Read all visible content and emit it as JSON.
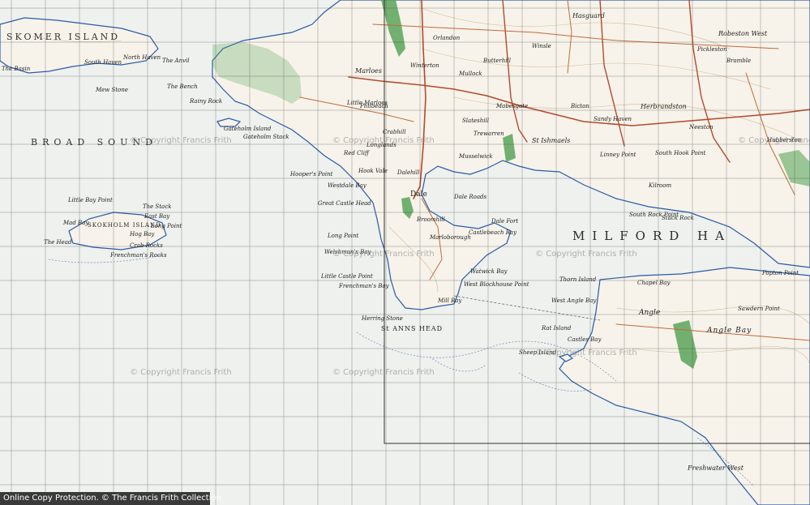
{
  "map": {
    "labels": {
      "skomer_island": "SKOMER ISLAND",
      "broad_sound": "BROAD SOUND",
      "milford_haven": "MILFORD HA",
      "st_anns_head": "St ANNS HEAD",
      "angle_bay": "Angle Bay",
      "skokholm_island": "SKOKHOLM ISLAND",
      "marloes": "Marloes",
      "dale": "Dale",
      "dale_roads": "Dale Roads",
      "hasguard": "Hasguard",
      "herbrandston": "Herbrandston",
      "robeston_west": "Robeston West",
      "st_ishmaels": "St Ishmaels",
      "angle": "Angle",
      "little_marloes": "Little Marloes",
      "mullock": "Mullock",
      "winterton": "Winterton",
      "orlandon": "Orlandon",
      "hooks_vale": "Hook Vale",
      "westdale_bay": "Westdale Bay",
      "great_castle_head": "Great Castle Head",
      "long_point": "Long Point",
      "welshmans_bay": "Welshman's Bay",
      "little_castle_point": "Little Castle Point",
      "frenchmans_bay": "Frenchman's Bay",
      "herring_stone": "Herring Stone",
      "mill_bay": "Mill Bay",
      "west_blockhouse_point": "West Blockhouse Point",
      "watwick_bay": "Watwick Bay",
      "castlebeach_bay": "Castlebeach Bay",
      "dale_fort": "Dale Fort",
      "marloborough": "Marloborough",
      "broomhill": "Broomhill",
      "thorn_island": "Thorn Island",
      "west_angle_bay": "West Angle Bay",
      "chapel_bay": "Chapel Bay",
      "rat_island": "Rat Island",
      "sheep_island": "Sheep Island",
      "castles_bay": "Castles Bay",
      "freshwater_west": "Freshwater West",
      "mew_stone": "Mew Stone",
      "the_basin": "The Basin",
      "the_head": "The Head",
      "crab_rocks": "Crab Rocks",
      "frenchmans_rocks": "Frenchman's Rocks",
      "the_stack": "The Stack",
      "east_bay": "East Bay",
      "long_point_s": "Long Point",
      "hog_bay": "Hog Bay",
      "mad_bay": "Mad Bay",
      "little_bay_point": "Little Bay Point",
      "north_haven": "North Haven",
      "south_haven": "South Haven",
      "the_anvil": "The Anvil",
      "the_bench": "The Bench",
      "rainy_rock": "Rainy Rock",
      "gateholm_island": "Gateholm Island",
      "gateholm_stack": "Gateholm Stack",
      "hoopers_point": "Hooper's Point",
      "red_cliff": "Red Cliff",
      "longlands": "Longlands",
      "dalehill": "Dalehill",
      "crabhill": "Crabhill",
      "philbeach": "Philbeach",
      "musselwick": "Musselwick",
      "butterhill": "Butterhill",
      "winsle": "Winsle",
      "mabesgate": "Mabesgate",
      "trewarren": "Trewarren",
      "slateshill": "Slateshill",
      "sandy_haven": "Sandy Haven",
      "bicton": "Bicton",
      "neeston": "Neeston",
      "south_hook_point": "South Hook Point",
      "stack_rock": "Stack Rock",
      "kilroom": "Kilroom",
      "south_rock_point": "South Rock Point",
      "popton_point": "Popton Point",
      "sawdern_point": "Sawdern Point",
      "bramble": "Bramble",
      "pickleston": "Pickleston",
      "hubberston": "Hubberston",
      "linney_point": "Linney Point"
    },
    "watermarks": [
      "© Copyright Francis Frith",
      "© Copyright Francis Frith",
      "© Copyright Francis Frith",
      "© Copyright Francis Frith",
      "© Copyright Francis Frith",
      "© Copyright Francis Frith",
      "© Copyright Francis Frith",
      "© Copyright Francis Frith"
    ],
    "colors": {
      "sea": "#eef1ee",
      "land": "#f7f3ea",
      "coast": "#2b5aa8",
      "grid": "#3b3b3b",
      "road_major": "#b54a2b",
      "road_minor": "#c26a3c",
      "woodland": "#5aa55a",
      "contour": "#c8a070",
      "footer_bg": "#3a3a3a"
    }
  },
  "footer": {
    "text": "Online Copy Protection. © The Francis Frith Collection"
  }
}
